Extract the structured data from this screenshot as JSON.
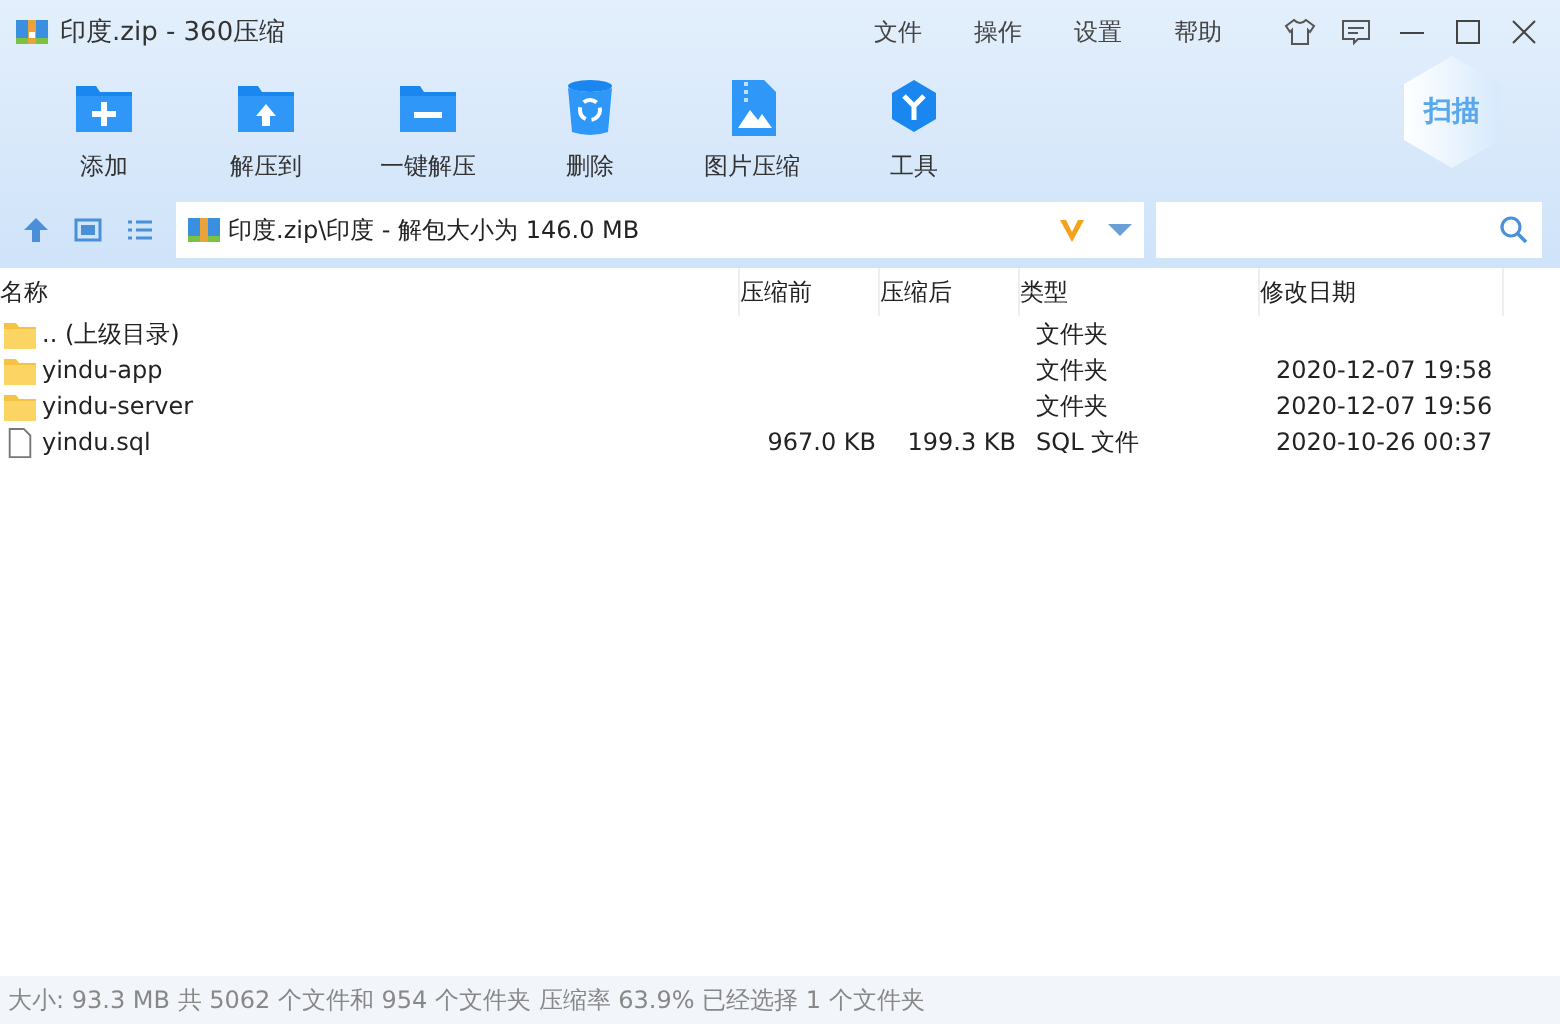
{
  "window": {
    "title": "印度.zip - 360压缩"
  },
  "menu": [
    "文件",
    "操作",
    "设置",
    "帮助"
  ],
  "toolbar": [
    {
      "kind": "add",
      "label": "添加"
    },
    {
      "kind": "extract",
      "label": "解压到"
    },
    {
      "kind": "oneclick",
      "label": "一键解压"
    },
    {
      "kind": "delete",
      "label": "删除"
    },
    {
      "kind": "image",
      "label": "图片压缩"
    },
    {
      "kind": "tools",
      "label": "工具"
    }
  ],
  "scan_button": {
    "label": "扫描"
  },
  "address": {
    "value": "印度.zip\\印度 - 解包大小为 146.0 MB"
  },
  "table": {
    "columns": [
      "名称",
      "压缩前",
      "压缩后",
      "类型",
      "修改日期"
    ],
    "rows": [
      {
        "kind": "folder",
        "name": ".. (上级目录)",
        "size": "",
        "packed": "",
        "type": "文件夹",
        "modified": ""
      },
      {
        "kind": "folder",
        "name": "yindu-app",
        "size": "",
        "packed": "",
        "type": "文件夹",
        "modified": "2020-12-07 19:58"
      },
      {
        "kind": "folder",
        "name": "yindu-server",
        "size": "",
        "packed": "",
        "type": "文件夹",
        "modified": "2020-12-07 19:56"
      },
      {
        "kind": "file",
        "name": "yindu.sql",
        "size": "967.0 KB",
        "packed": "199.3 KB",
        "type": "SQL 文件",
        "modified": "2020-10-26 00:37"
      }
    ]
  },
  "status_bar": "大小: 93.3 MB 共 5062 个文件和 954 个文件夹 压缩率 63.9% 已经选择 1 个文件夹"
}
